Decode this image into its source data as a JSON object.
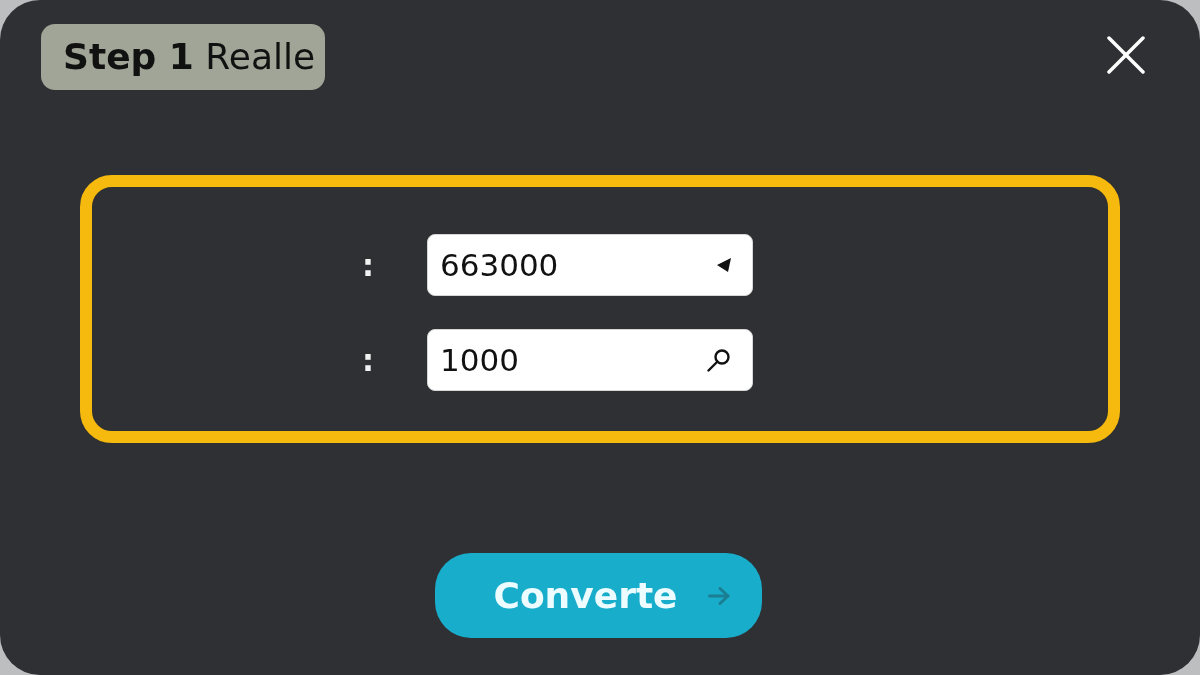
{
  "dialog": {
    "title": "**Step 1** Realle"
  },
  "fields": [
    {
      "label": ":",
      "value": "663000",
      "kind": "triangle"
    },
    {
      "label": ":",
      "value": "1000",
      "kind": "search"
    }
  ],
  "button": {
    "label": "Converte"
  }
}
